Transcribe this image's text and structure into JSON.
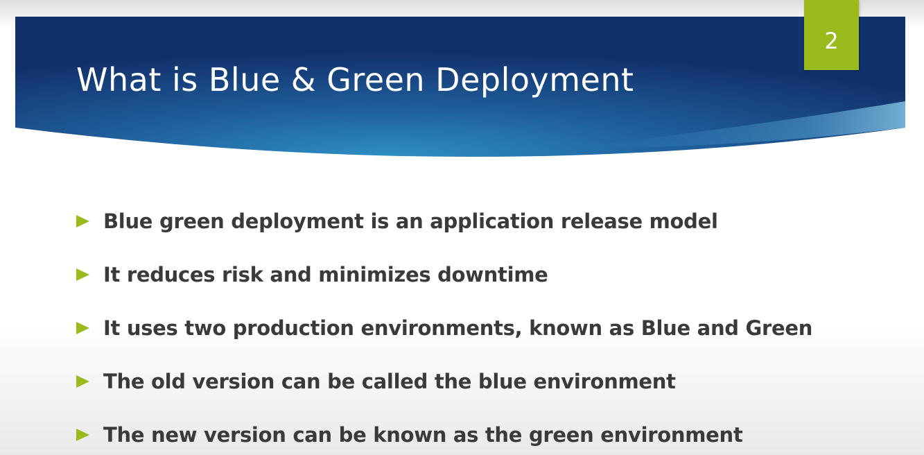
{
  "slide": {
    "title": "What is Blue & Green Deployment",
    "page_number": "2",
    "bullet_icon": "triangle-arrow-right-icon",
    "bullets": [
      "Blue green deployment is an application release model",
      "It reduces risk and minimizes downtime",
      "It uses two production environments, known as Blue and Green",
      "The old version can be called the blue environment",
      "The new version can be known as the green environment"
    ]
  },
  "colors": {
    "banner_dark": "#12306b",
    "banner_light": "#2a88c0",
    "accent_green": "#9bbb1d",
    "text_dark": "#3a3a3a",
    "title_text": "#ffffff"
  }
}
